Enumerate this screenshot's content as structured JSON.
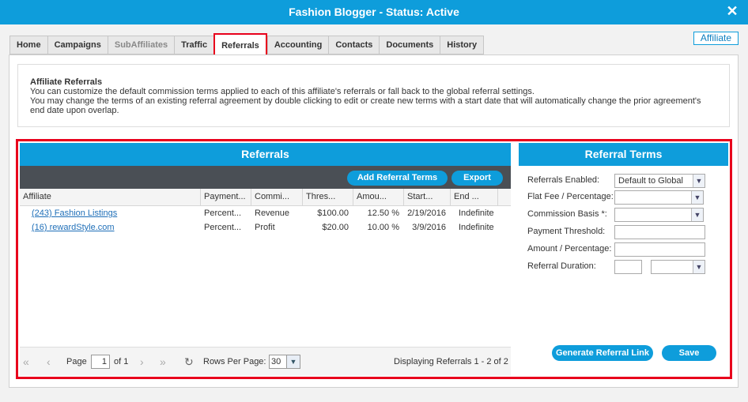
{
  "window": {
    "title": "Fashion Blogger - Status: Active",
    "close_glyph": "✕"
  },
  "badge": {
    "label": "Affiliate"
  },
  "tabs": [
    {
      "label": "Home"
    },
    {
      "label": "Campaigns"
    },
    {
      "label": "SubAffiliates"
    },
    {
      "label": "Traffic"
    },
    {
      "label": "Referrals"
    },
    {
      "label": "Accounting"
    },
    {
      "label": "Contacts"
    },
    {
      "label": "Documents"
    },
    {
      "label": "History"
    }
  ],
  "info": {
    "heading": "Affiliate Referrals",
    "line1": "You can customize the default commission terms applied to each of this affiliate's referrals or fall back to the global referral settings.",
    "line2": "You may change the terms of an existing referral agreement by double clicking to edit or create new terms with a start date that will automatically change the prior agreement's end date upon overlap."
  },
  "referrals": {
    "title": "Referrals",
    "add_label": "Add Referral Terms",
    "export_label": "Export",
    "columns": [
      "Affiliate",
      "Payment...",
      "Commi...",
      "Thres...",
      "Amou...",
      "Start...",
      "End ..."
    ],
    "rows": [
      {
        "affiliate": "(243) Fashion Listings",
        "payment": "Percent...",
        "commission": "Revenue",
        "threshold": "$100.00",
        "amount": "12.50 %",
        "start": "2/19/2016",
        "end": "Indefinite"
      },
      {
        "affiliate": "(16) rewardStyle.com",
        "payment": "Percent...",
        "commission": "Profit",
        "threshold": "$20.00",
        "amount": "10.00 %",
        "start": "3/9/2016",
        "end": "Indefinite"
      }
    ],
    "pager": {
      "first": "«",
      "prev": "‹",
      "next": "›",
      "last": "»",
      "refresh": "↻",
      "page_label": "Page",
      "page_value": "1",
      "of_label": "of 1",
      "rows_label": "Rows Per Page:",
      "rows_value": "30",
      "status": "Displaying Referrals 1 - 2 of 2"
    }
  },
  "terms": {
    "title": "Referral Terms",
    "labels": {
      "enabled": "Referrals Enabled:",
      "flat": "Flat Fee / Percentage:",
      "basis": "Commission Basis *:",
      "threshold": "Payment Threshold:",
      "amount": "Amount / Percentage:",
      "duration": "Referral Duration:"
    },
    "enabled_value": "Default to Global",
    "dropdown_glyph": "▼",
    "generate_label": "Generate Referral Link",
    "save_label": "Save"
  }
}
